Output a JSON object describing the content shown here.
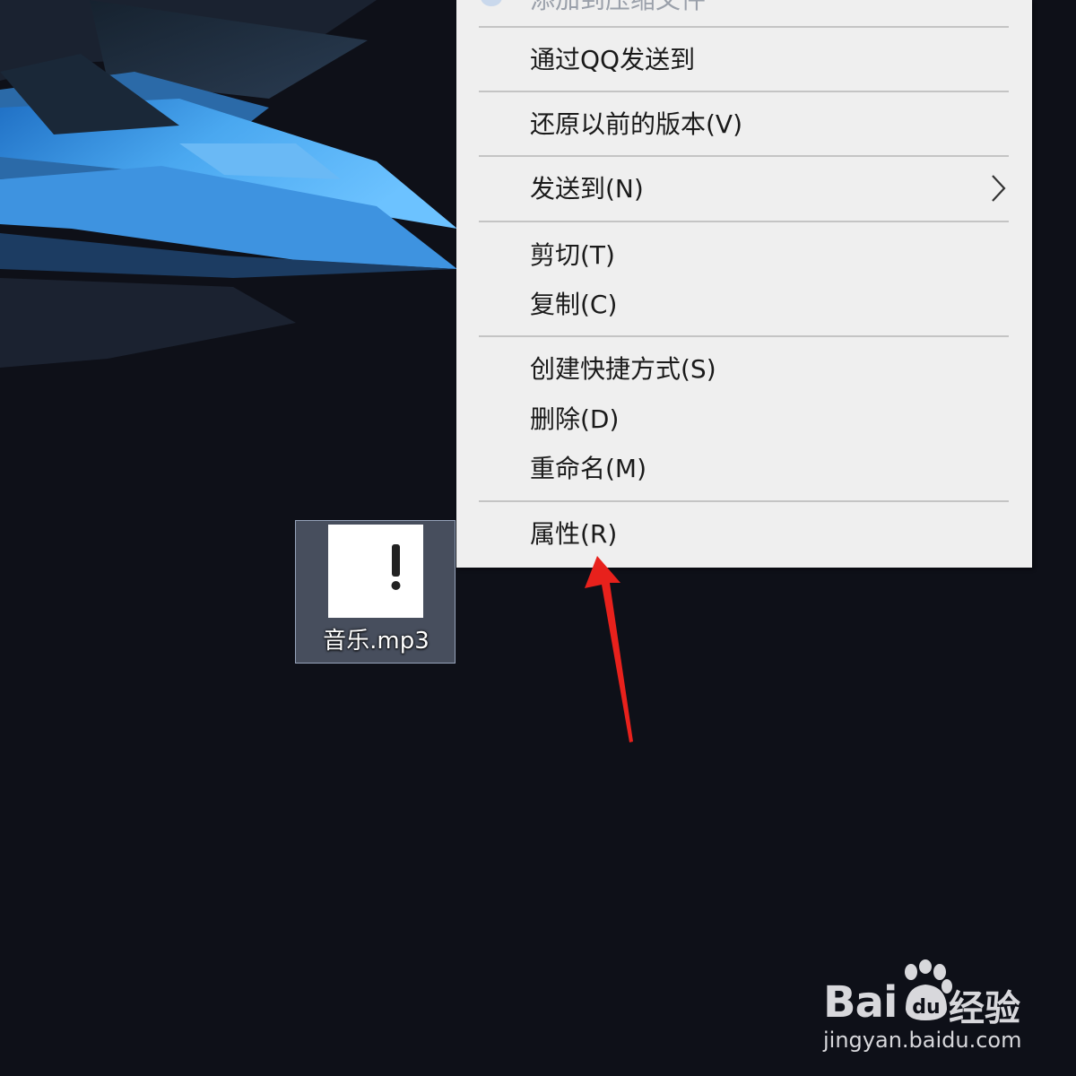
{
  "desktop": {
    "file": {
      "name": "音乐.mp3",
      "icon": "unknown-file-exclamation-icon"
    }
  },
  "context_menu": {
    "partial_top_item": "添加到压缩文件",
    "items": [
      {
        "label": "通过QQ发送到"
      },
      {
        "label": "还原以前的版本(V)"
      },
      {
        "label": "发送到(N)",
        "has_submenu": true
      },
      {
        "label": "剪切(T)"
      },
      {
        "label": "复制(C)"
      },
      {
        "label": "创建快捷方式(S)"
      },
      {
        "label": "删除(D)"
      },
      {
        "label": "重命名(M)"
      },
      {
        "label": "属性(R)"
      }
    ]
  },
  "annotation": {
    "arrow_color": "#e8211c",
    "points_to": "属性(R)"
  },
  "watermark": {
    "brand": "Bai",
    "brand_suffix": "du",
    "product": "经验",
    "url": "jingyan.baidu.com"
  },
  "colors": {
    "desktop_bg": "#0e1018",
    "menu_bg": "#efefef",
    "wallpaper_accent": "#4aa8f0"
  }
}
